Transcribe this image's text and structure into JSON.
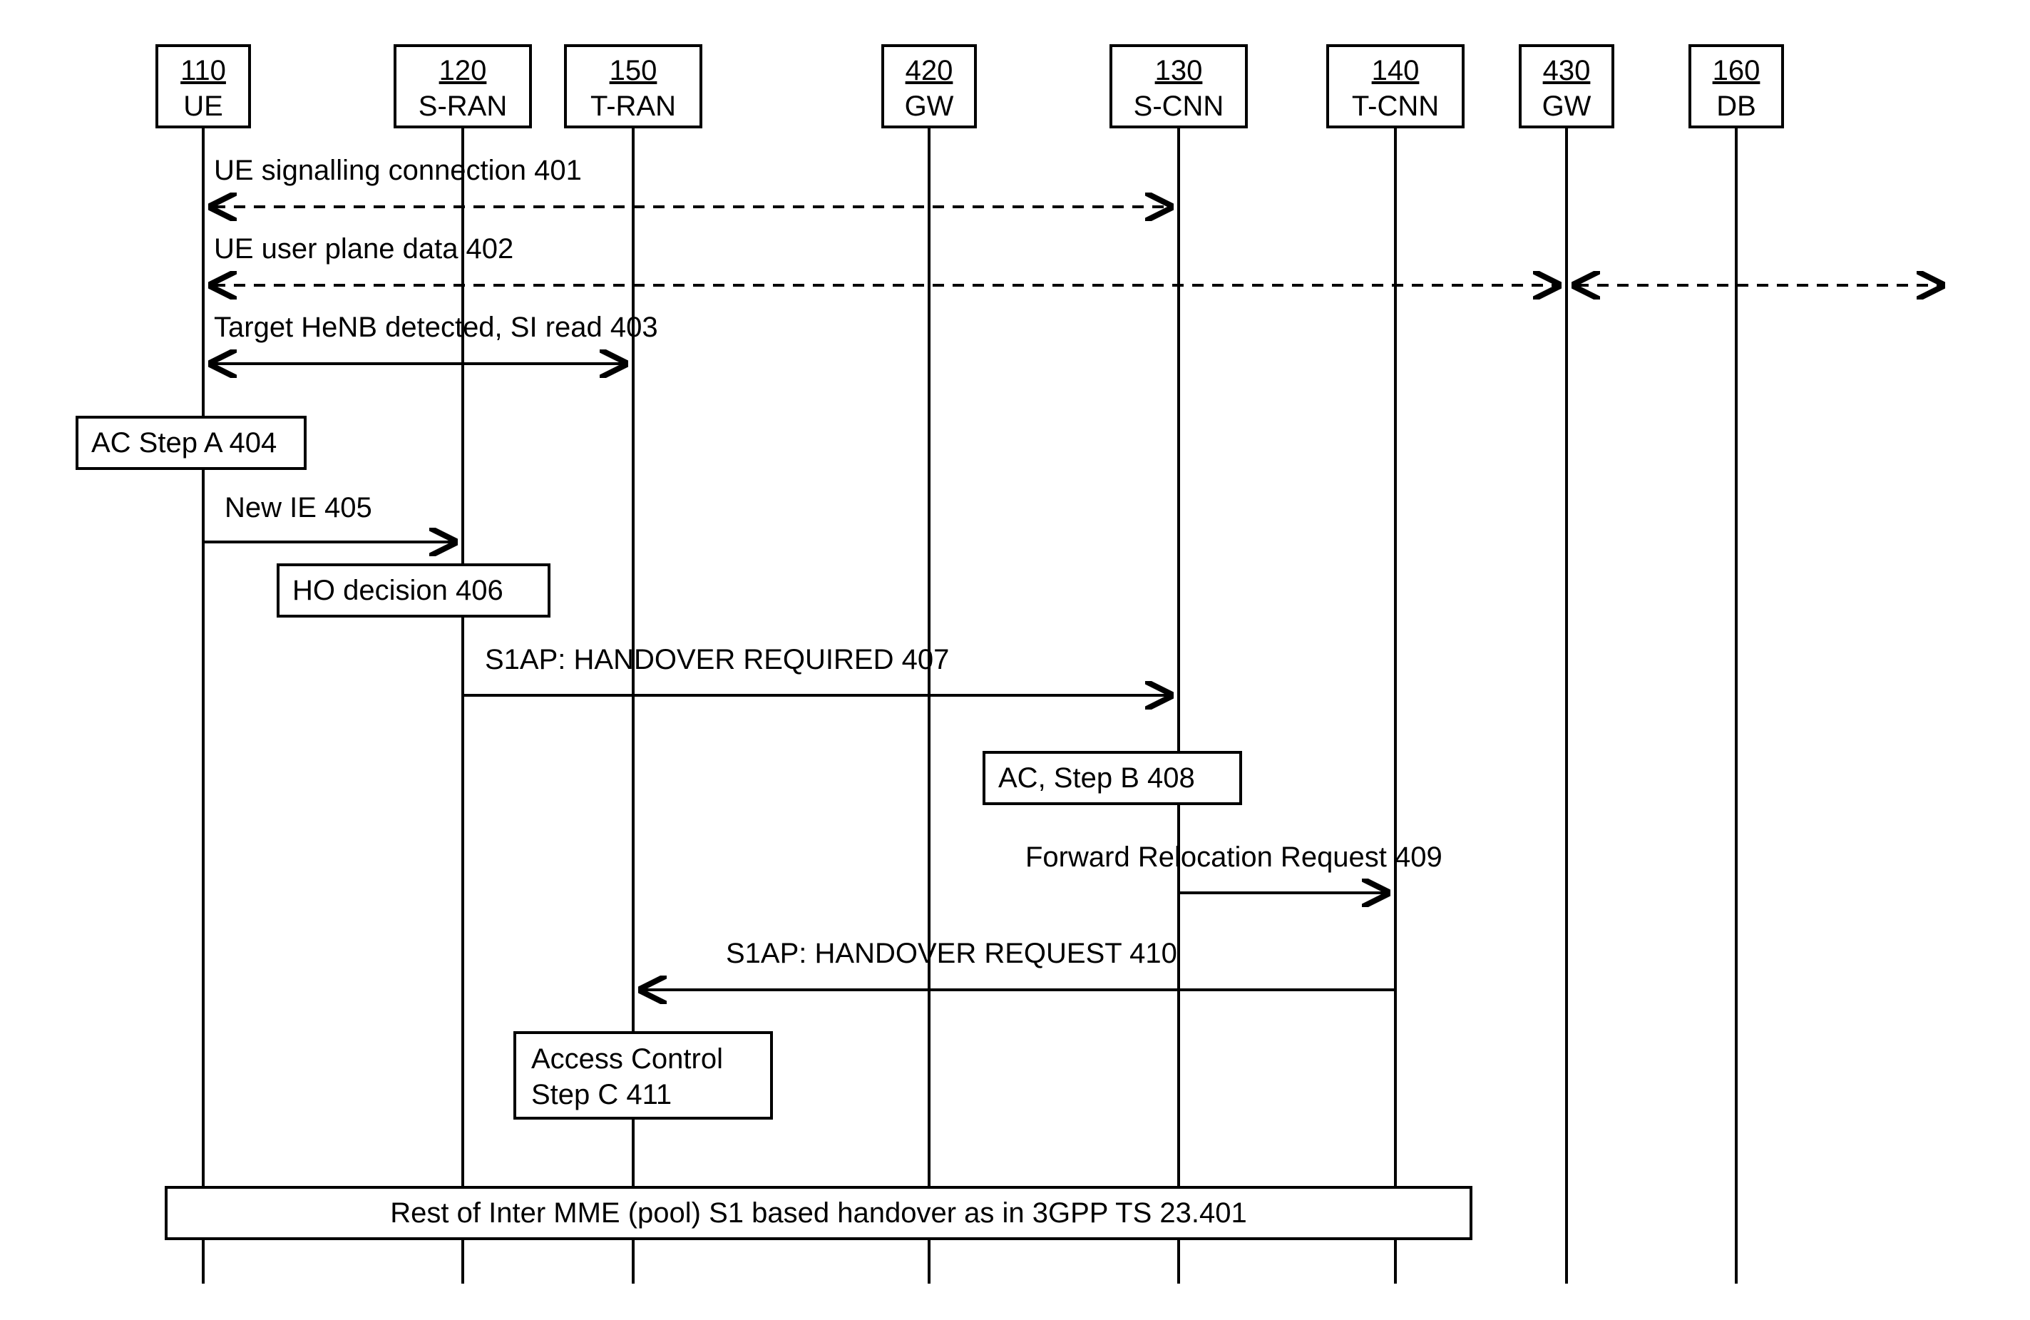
{
  "actors": {
    "ue": {
      "num": "110",
      "lbl": "UE"
    },
    "sran": {
      "num": "120",
      "lbl": "S-RAN"
    },
    "tran": {
      "num": "150",
      "lbl": "T-RAN"
    },
    "gw1": {
      "num": "420",
      "lbl": "GW"
    },
    "scnn": {
      "num": "130",
      "lbl": "S-CNN"
    },
    "tcnn": {
      "num": "140",
      "lbl": "T-CNN"
    },
    "gw2": {
      "num": "430",
      "lbl": "GW"
    },
    "db": {
      "num": "160",
      "lbl": "DB"
    }
  },
  "msgs": {
    "m401": "UE signalling connection 401",
    "m402": "UE user plane data 402",
    "m403": "Target HeNB detected, SI read 403",
    "m404": "AC Step A 404",
    "m405": "New IE 405",
    "m406": "HO decision 406",
    "m407": "S1AP: HANDOVER REQUIRED 407",
    "m408": "AC, Step B 408",
    "m409": "Forward Relocation Request 409",
    "m410": "S1AP: HANDOVER REQUEST 410",
    "m411a": "Access Control",
    "m411b": "Step C 411",
    "footer": "Rest of Inter MME (pool) S1 based handover as in 3GPP TS 23.401"
  }
}
